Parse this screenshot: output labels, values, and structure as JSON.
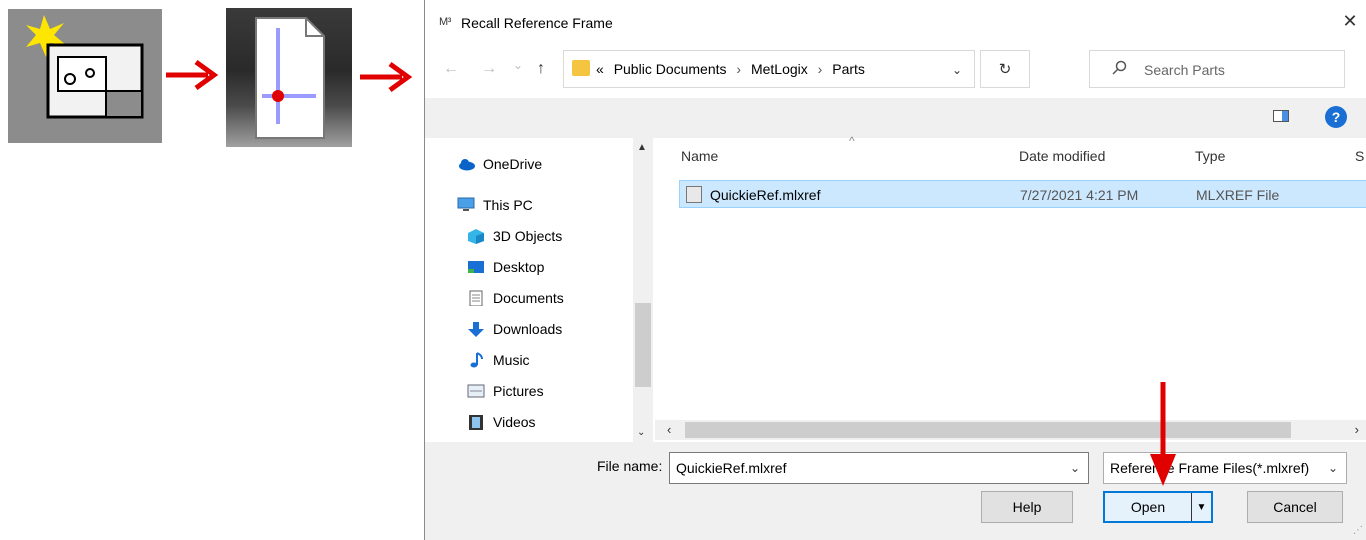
{
  "dialog": {
    "app_icon_text": "M³",
    "title": "Recall Reference Frame",
    "close_glyph": "✕"
  },
  "navbar": {
    "back_glyph": "←",
    "forward_glyph": "→",
    "recent_glyph": "⌄",
    "up_glyph": "↑",
    "breadcrumb": [
      "«",
      "Public Documents",
      "›",
      "MetLogix",
      "›",
      "Parts"
    ],
    "address_dropdown": "⌄",
    "refresh_glyph": "↻",
    "search_placeholder": "Search Parts"
  },
  "nav_pane": {
    "items": [
      {
        "label": "OneDrive",
        "icon": "onedrive-icon"
      },
      {
        "label": "This PC",
        "icon": "computer-icon"
      },
      {
        "label": "3D Objects",
        "icon": "3d-objects-icon"
      },
      {
        "label": "Desktop",
        "icon": "desktop-icon"
      },
      {
        "label": "Documents",
        "icon": "documents-icon"
      },
      {
        "label": "Downloads",
        "icon": "downloads-icon"
      },
      {
        "label": "Music",
        "icon": "music-icon"
      },
      {
        "label": "Pictures",
        "icon": "pictures-icon"
      },
      {
        "label": "Videos",
        "icon": "videos-icon"
      }
    ]
  },
  "file_list": {
    "columns": [
      "Name",
      "Date modified",
      "Type",
      "S"
    ],
    "rows": [
      {
        "name": "QuickieRef.mlxref",
        "date": "7/27/2021 4:21 PM",
        "type": "MLXREF File"
      }
    ]
  },
  "bottom": {
    "file_name_label": "File name:",
    "file_name_value": "QuickieRef.mlxref",
    "file_type_value": "Reference Frame Files(*.mlxref)",
    "help_label": "Help",
    "open_label": "Open",
    "cancel_label": "Cancel"
  },
  "colors": {
    "accent": "#0078d7",
    "selection": "#cce8ff",
    "annotation_arrow": "#e00000"
  }
}
